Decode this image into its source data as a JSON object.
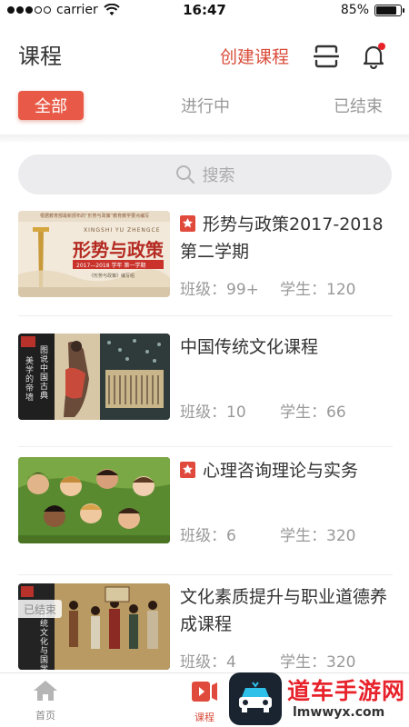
{
  "status_bar": {
    "carrier": "carrier",
    "time": "16:47",
    "battery": "85%",
    "battery_level": 0.85
  },
  "header": {
    "title": "课程",
    "create_label": "创建课程"
  },
  "tabs": [
    {
      "label": "全部",
      "active": true
    },
    {
      "label": "进行中",
      "active": false
    },
    {
      "label": "已结束",
      "active": false
    }
  ],
  "search": {
    "placeholder": "搜索"
  },
  "courses": [
    {
      "title": "形势与政策2017-2018第二学期",
      "pinned": true,
      "class_label": "班级：99+",
      "student_label": "学生：120",
      "thumb": {
        "top_note": "根据教育部最新颁布的“形势与政策”教育教学要点编写",
        "pinyin": "XINGSHI YU ZHENGCE",
        "heading": "形势与政策",
        "term": "2017—2018 学年 第一学期",
        "editor": "《形势与政策》编写组"
      }
    },
    {
      "title": "中国传统文化课程",
      "pinned": false,
      "class_label": "班级：10",
      "student_label": "学生：66",
      "thumb": {
        "side_text": "美学的帝墙",
        "vertical_text": "图说中国古典"
      }
    },
    {
      "title": "心理咨询理论与实务",
      "pinned": true,
      "class_label": "班级：6",
      "student_label": "学生：320",
      "thumb": {}
    },
    {
      "title": "文化素质提升与职业道德养成课程",
      "pinned": false,
      "ended": true,
      "ended_label": "已结束",
      "class_label": "班级：4",
      "student_label": "学生：320",
      "thumb": {
        "vertical_text": "传统文化与国学教育"
      }
    }
  ],
  "tabbar": [
    {
      "label": "首页",
      "icon": "home-icon",
      "active": false
    },
    {
      "label": "课程",
      "icon": "course-icon",
      "active": true
    }
  ],
  "watermark": {
    "title": "道车手游网",
    "url": "lmwwyx.com"
  },
  "colors": {
    "accent": "#e85a47",
    "text": "#333333",
    "muted": "#999999"
  }
}
